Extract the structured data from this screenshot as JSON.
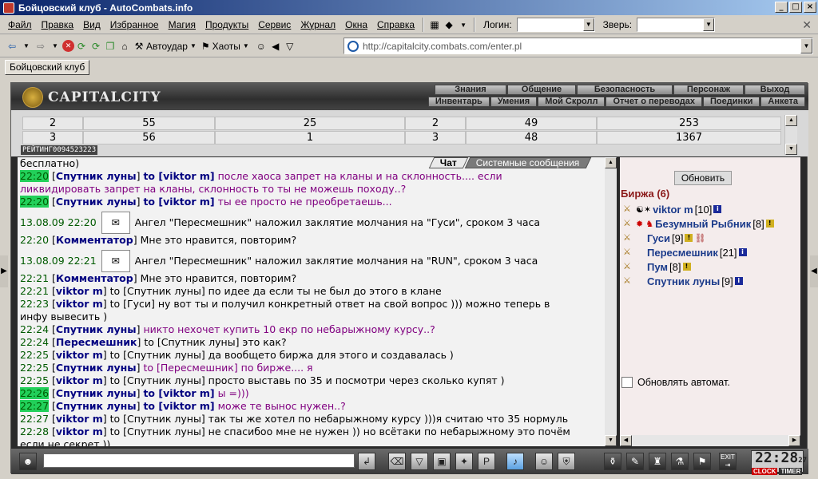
{
  "window": {
    "title": "Бойцовский клуб - AutoCombats.info"
  },
  "menu": {
    "items": [
      "Файл",
      "Правка",
      "Вид",
      "Избранное",
      "Магия",
      "Продукты",
      "Сервис",
      "Журнал",
      "Окна",
      "Справка"
    ],
    "login_label": "Логин:",
    "beast_label": "Зверь:"
  },
  "toolbar": {
    "autoudar": "Автоудар",
    "haoty": "Хаоты",
    "address": "http://capitalcity.combats.com/enter.pl"
  },
  "tabs": [
    "Бойцовский клуб"
  ],
  "game": {
    "logo": "CAPITALCITY",
    "nav_top": [
      "Знания",
      "Общение",
      "Безопасность",
      "Персонаж",
      "Выход"
    ],
    "nav_bottom": [
      "Инвентарь",
      "Умения",
      "Мой Скролл",
      "Отчет о переводах",
      "Поединки",
      "Анкета"
    ],
    "rating_label": "РЕЙТИНГ0094523223",
    "rating_rows": [
      [
        "2",
        "55",
        "25",
        "2",
        "49",
        "253"
      ],
      [
        "3",
        "56",
        "1",
        "3",
        "48",
        "1367"
      ]
    ]
  },
  "chat": {
    "tabs": [
      "Чат",
      "Системные сообщения"
    ],
    "lines": [
      {
        "text": "бесплатно)"
      },
      {
        "ts": "22:20",
        "hl": true,
        "nick": "Спутник луны",
        "to": "to [viktor m]",
        "msg": "после хаоса запрет на кланы и на склонность.... если",
        "priv": true
      },
      {
        "text": "ликвидировать запрет на кланы, склонность то ты не можешь походу..?",
        "priv": true
      },
      {
        "ts": "22:20",
        "hl": true,
        "nick": "Спутник луны",
        "to": "to [viktor m]",
        "msg": "ты ее просто не преобретаешь...",
        "priv": true
      },
      {
        "sys_ts": "13.08.09 22:20",
        "sys": "Ангел \"Пересмешник\" наложил заклятие молчания на \"Гуси\", сроком 3 часа"
      },
      {
        "ts": "22:20",
        "nick": "Комментатор",
        "msg": "Мне это нравится, повторим?"
      },
      {
        "sys_ts": "13.08.09 22:21",
        "sys": "Ангел \"Пересмешник\" наложил заклятие молчания на \"RUN\", сроком 3 часа"
      },
      {
        "ts": "22:21",
        "nick": "Комментатор",
        "msg": "Мне это нравится, повторим?"
      },
      {
        "ts": "22:21",
        "nick": "viktor m",
        "msg": "to [Спутник луны] по идее да если ты не был до этого в клане"
      },
      {
        "ts": "22:23",
        "nick": "viktor m",
        "msg": "to [Гуси] ну вот ты и получил конкретный ответ на свой вопрос ))) можно теперь в"
      },
      {
        "text": "инфу вывесить )"
      },
      {
        "ts": "22:24",
        "nick": "Спутник луны",
        "msg": "никто нехочет купить 10 екр по небарыжному курсу..?",
        "priv": true
      },
      {
        "ts": "22:24",
        "nick": "Пересмешник",
        "msg": "to [Спутник луны] это как?"
      },
      {
        "ts": "22:25",
        "nick": "viktor m",
        "msg": "to [Спутник луны] да вообщето биржа для этого и создавалась )"
      },
      {
        "ts": "22:25",
        "nick": "Спутник луны",
        "msg": "to [Пересмешник] по бирже.... я",
        "priv": true
      },
      {
        "ts": "22:25",
        "nick": "viktor m",
        "msg": "to [Спутник луны] просто выставь по 35 и посмотри через сколько купят )"
      },
      {
        "ts": "22:26",
        "hl": true,
        "nick": "Спутник луны",
        "to": "to [viktor m]",
        "msg": "ы =)))",
        "priv": true
      },
      {
        "ts": "22:27",
        "hl": true,
        "nick": "Спутник луны",
        "to": "to [viktor m]",
        "msg": "може те вынос нужен..?",
        "priv": true
      },
      {
        "ts": "22:27",
        "nick": "viktor m",
        "msg": "to [Спутник луны] так ты же хотел по небарыжному курсу )))я считаю что 35 нормуль"
      },
      {
        "ts": "22:28",
        "nick": "viktor m",
        "msg": "to [Спутник луны] не спасибоо мне не нужен )) но всётаки по небарыжному это почём"
      },
      {
        "text": "если не секрет ))"
      }
    ]
  },
  "panel": {
    "refresh": "Обновить",
    "room": "Биржа (6)",
    "users": [
      {
        "nick": "viktor m",
        "lvl": "[10]"
      },
      {
        "nick": "Безумный Рыбник",
        "lvl": "[8]"
      },
      {
        "nick": "Гуси",
        "lvl": "[9]"
      },
      {
        "nick": "Пересмешник",
        "lvl": "[21]"
      },
      {
        "nick": "Пум",
        "lvl": "[8]"
      },
      {
        "nick": "Спутник луны",
        "lvl": "[9]"
      }
    ],
    "autorefresh": "Обновлять автомат."
  },
  "bottom": {
    "clock": "22:28",
    "clock_sec": "27",
    "clock_label": "CLOCK",
    "timer_label": "TIMER",
    "exit_label": "EXIT"
  }
}
